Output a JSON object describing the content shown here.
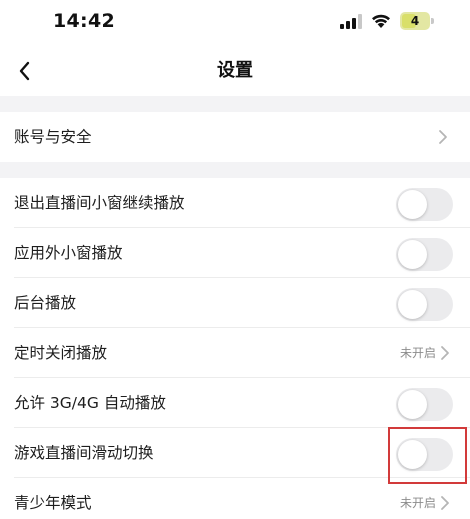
{
  "status_bar": {
    "time": "14:42",
    "battery_level": "4",
    "icons": [
      "signal-icon",
      "wifi-icon",
      "battery-icon"
    ]
  },
  "nav": {
    "title": "设置",
    "back_icon": "chevron-left-icon"
  },
  "sections": [
    {
      "rows": [
        {
          "label": "账号与安全",
          "control": "chevron"
        }
      ]
    },
    {
      "rows": [
        {
          "label": "退出直播间小窗继续播放",
          "control": "toggle",
          "on": false
        },
        {
          "label": "应用外小窗播放",
          "control": "toggle",
          "on": false
        },
        {
          "label": "后台播放",
          "control": "toggle",
          "on": false
        },
        {
          "label": "定时关闭播放",
          "control": "value-chevron",
          "value": "未开启"
        },
        {
          "label": "允许 3G/4G 自动播放",
          "control": "toggle",
          "on": false
        },
        {
          "label": "游戏直播间滑动切换",
          "control": "toggle",
          "on": false,
          "highlighted": true
        },
        {
          "label": "青少年模式",
          "control": "value-chevron",
          "value": "未开启"
        }
      ]
    }
  ],
  "colors": {
    "toggle_off": "#ebebed",
    "section_gap": "#f3f3f5",
    "highlight_border": "#d23a3a",
    "secondary_text": "#8c8c8c"
  }
}
